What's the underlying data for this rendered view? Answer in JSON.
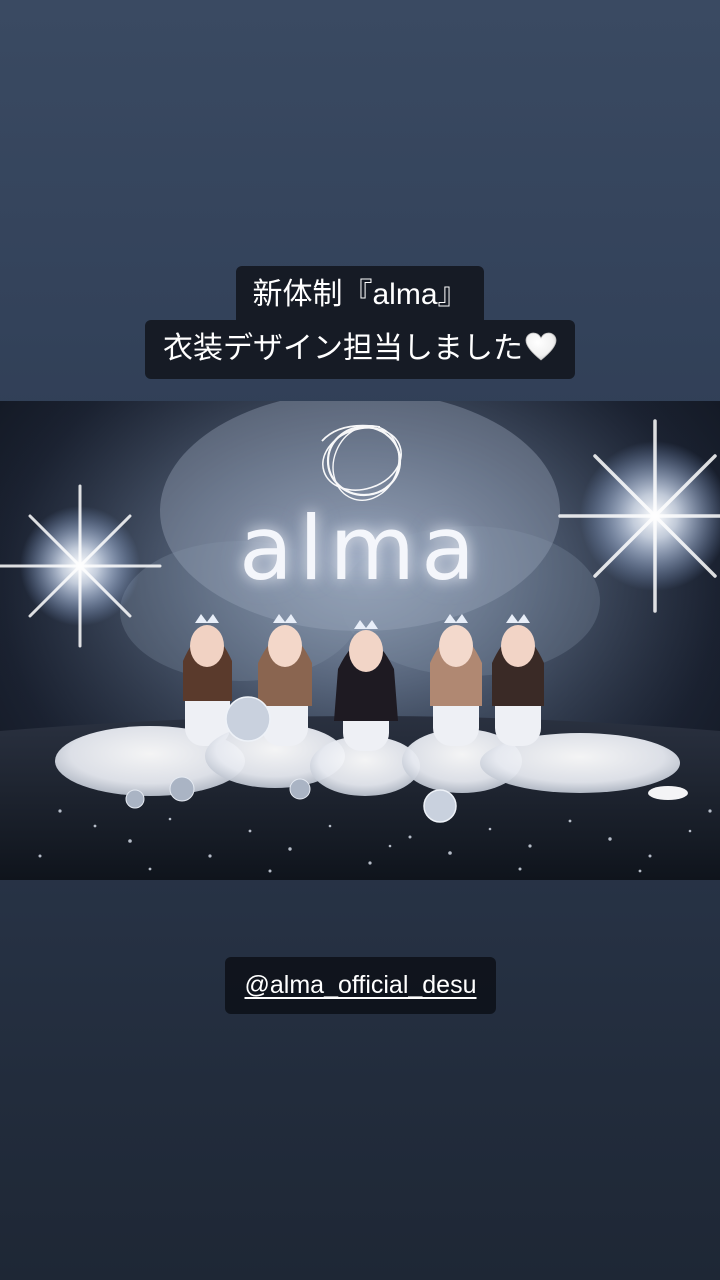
{
  "caption": {
    "line1_prefix": "新体制『",
    "line1_name": "alma",
    "line1_suffix": "』",
    "line2": "衣装デザイン担当しました",
    "line2_emoji_icon": "white-heart-icon"
  },
  "photo": {
    "logo_text": "alma",
    "logo_icon": "alma-ring-logo-icon",
    "people_count": 5
  },
  "mention": {
    "handle": "@alma_official_desu"
  },
  "colors": {
    "background_top": "#3a4a62",
    "background_bottom": "#1e2735",
    "sticker_bg": "#12161e",
    "text": "#ffffff"
  }
}
